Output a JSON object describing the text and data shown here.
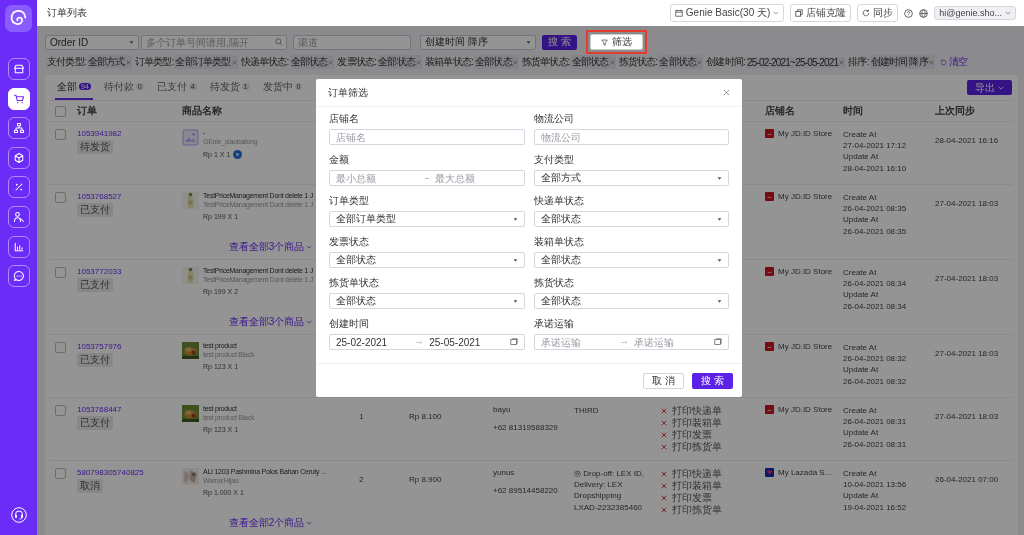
{
  "sidebar": {
    "items": [
      {
        "selected": false
      },
      {
        "selected": true
      },
      {
        "selected": false
      },
      {
        "selected": false
      },
      {
        "selected": false
      },
      {
        "selected": false
      },
      {
        "selected": false
      },
      {
        "selected": false
      }
    ]
  },
  "header": {
    "title": "订单列表",
    "plan": "Genie Basic(30 天)",
    "clone_button": "店铺克隆",
    "sync_button": "同步",
    "account": "hi@genie.sho..."
  },
  "toolbar": {
    "search_by": "Order ID",
    "order_search": {
      "placeholder": "多个订单号间请用,隔开"
    },
    "channel": {
      "placeholder": "渠道"
    },
    "sort": "创建时间 降序",
    "search_button": "搜 索",
    "filter_button": {
      "label": "筛选",
      "highlighted": true
    }
  },
  "active_filters": [
    {
      "label": "支付类型:",
      "value": "全部方式"
    },
    {
      "label": "订单类型:",
      "value": "全部订单类型"
    },
    {
      "label": "快递单状态:",
      "value": "全部状态"
    },
    {
      "label": "发票状态:",
      "value": "全部状态"
    },
    {
      "label": "装箱单状态:",
      "value": "全部状态"
    },
    {
      "label": "拣货单状态:",
      "value": "全部状态"
    },
    {
      "label": "拣货状态:",
      "value": "全部状态"
    },
    {
      "label": "创建时间:",
      "value": "25-02-2021~25-05-2021"
    },
    {
      "label": "排序:",
      "value": "创建时间 降序"
    }
  ],
  "clear_button": "清空",
  "tabs": [
    {
      "label": "全部",
      "count": "94",
      "selected": true
    },
    {
      "label": "待付款",
      "count": "0",
      "selected": false
    },
    {
      "label": "已支付",
      "count": "4",
      "selected": false
    },
    {
      "label": "待发货",
      "count": "1",
      "selected": false
    },
    {
      "label": "发货中",
      "count": "0",
      "selected": false
    }
  ],
  "export_button": "导出",
  "table": {
    "select_all": {
      "checked": false
    },
    "columns": [
      "订单",
      "商品名称",
      "店铺名",
      "时间",
      "上次同步"
    ],
    "rows": [
      {
        "checked": false,
        "order_id": "1053941982",
        "status": "待发货",
        "product": {
          "thumb": {
            "kind": "placeholder"
          },
          "name": "-",
          "variant": "GEnie_xiaobailong",
          "price": "Rp 1 X 1",
          "badge": true
        },
        "store": {
          "kind": "jd",
          "name": "My JD.ID Store"
        },
        "time": [
          "Create At",
          "27-04-2021 17:12",
          "Update At",
          "28-04-2021 16:10"
        ],
        "last_sync": "28-04-2021 16:16"
      },
      {
        "checked": false,
        "order_id": "1053768527",
        "status": "已支付",
        "product": {
          "name": "TestPriceManagement Dont delete 1 J",
          "variant": "TestPriceManagement Dont delete 1 J",
          "price": "Rp 199 X 1",
          "badge": false,
          "more": "查看全部3个商品"
        },
        "store": {
          "kind": "jd",
          "name": "My JD.ID Store"
        },
        "time": [
          "Create At",
          "26-04-2021 08:35",
          "Update At",
          "26-04-2021 08:35"
        ],
        "last_sync": "27-04-2021 18:03"
      },
      {
        "checked": false,
        "order_id": "1053772033",
        "status": "已支付",
        "product": {
          "name": "TestPriceManagement Dont delete 1 J",
          "variant": "TestPriceManagement Dont delete 1 J",
          "price": "Rp 199 X 2",
          "badge": false,
          "more": "查看全部3个商品"
        },
        "store": {
          "kind": "jd",
          "name": "My JD.ID Store"
        },
        "time": [
          "Create At",
          "26-04-2021 08:34",
          "Update At",
          "26-04-2021 08:34"
        ],
        "last_sync": "27-04-2021 18:03"
      },
      {
        "checked": false,
        "order_id": "1053757976",
        "status": "已支付",
        "product": {
          "name": "test product",
          "variant": "test product Black",
          "price": "Rp 123 X 1",
          "badge": false
        },
        "store": {
          "kind": "jd",
          "name": "My JD.ID Store"
        },
        "time": [
          "Create At",
          "26-04-2021 08:32",
          "Update At",
          "26-04-2021 08:32"
        ],
        "last_sync": "27-04-2021 18:03"
      },
      {
        "checked": false,
        "order_id": "1053768447",
        "status": "已支付",
        "product": {
          "name": "test product",
          "variant": "test product Black",
          "price": "Rp 123 X 1",
          "badge": false
        },
        "quantity": "1",
        "amount": "Rp 8.100",
        "buyer": {
          "name": "bayu",
          "phone": "+62 81319588329"
        },
        "logistics": [
          "THIRD"
        ],
        "print_tasks": [
          {
            "label": "打印快递单",
            "done": false
          },
          {
            "label": "打印装箱单",
            "done": false
          },
          {
            "label": "打印发票",
            "done": false
          },
          {
            "label": "打印拣货单",
            "done": false
          }
        ],
        "store": {
          "kind": "jd",
          "name": "My JD.ID Store"
        },
        "time": [
          "Create At",
          "26-04-2021 08:31",
          "Update At",
          "26-04-2021 08:31"
        ],
        "last_sync": "27-04-2021 18:03"
      },
      {
        "checked": false,
        "order_id": "580798305740825",
        "status": "取消",
        "product": {
          "name": "ALI 1203 Pashmina Polos Bahan Ceruty ...",
          "variant": "Warna:Hijau",
          "price": "Rp 1.000 X 1",
          "badge": false,
          "more": "查看全部2个商品"
        },
        "quantity": "2",
        "amount": "Rp 8.900",
        "buyer": {
          "name": "yunus",
          "phone": "+62 89514458220"
        },
        "logistics": [
          "◎ Drop-off: LEX ID,",
          "Delivery: LEX",
          "Dropshipping",
          "LXAD-2232385460"
        ],
        "print_tasks": [
          {
            "label": "打印快递单",
            "done": false
          },
          {
            "label": "打印装箱单",
            "done": false
          },
          {
            "label": "打印发票",
            "done": false
          },
          {
            "label": "打印拣货单",
            "done": false
          }
        ],
        "store": {
          "kind": "lazada",
          "name": "My Lazada S..."
        },
        "time": [
          "Create At",
          "10-04-2021 13:56",
          "Update At",
          "19-04-2021 16:52"
        ],
        "last_sync": "26-04-2021 07:00"
      }
    ]
  },
  "filter_dialog": {
    "title": "订单筛选",
    "fields": [
      {
        "kind": "input",
        "label": "店铺名",
        "placeholder": "店铺名"
      },
      {
        "kind": "input",
        "label": "物流公司",
        "placeholder": "物流公司"
      },
      {
        "kind": "range",
        "label": "金额",
        "from": {
          "placeholder": "最小总额"
        },
        "to": {
          "placeholder": "最大总额"
        }
      },
      {
        "kind": "select",
        "label": "支付类型",
        "value": "全部方式"
      },
      {
        "kind": "select",
        "label": "订单类型",
        "value": "全部订单类型"
      },
      {
        "kind": "select",
        "label": "快递单状态",
        "value": "全部状态"
      },
      {
        "kind": "select",
        "label": "发票状态",
        "value": "全部状态"
      },
      {
        "kind": "select",
        "label": "装箱单状态",
        "value": "全部状态"
      },
      {
        "kind": "select",
        "label": "拣货单状态",
        "value": "全部状态"
      },
      {
        "kind": "select",
        "label": "拣货状态",
        "value": "全部状态"
      },
      {
        "kind": "daterange",
        "label": "创建时间",
        "from": {
          "value": "25-02-2021"
        },
        "to": {
          "value": "25-05-2021"
        }
      },
      {
        "kind": "daterange",
        "label": "承诺运输",
        "from": {
          "placeholder": "承诺运输"
        },
        "to": {
          "placeholder": "承诺运输"
        }
      }
    ],
    "cancel_button": "取 消",
    "search_button": "搜 索"
  }
}
